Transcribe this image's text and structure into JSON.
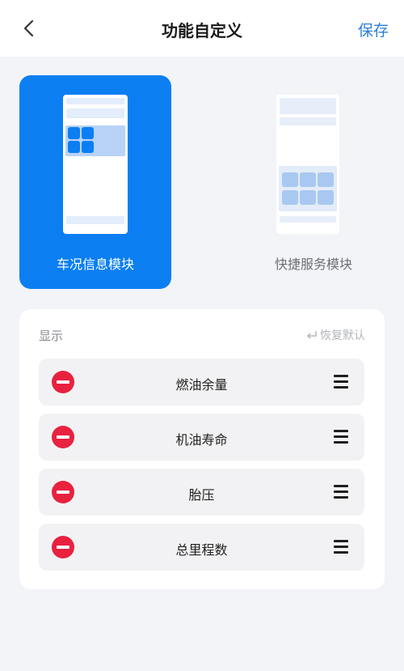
{
  "header": {
    "title": "功能自定义",
    "save_label": "保存",
    "back_icon": "chevron-left-icon"
  },
  "modules": [
    {
      "label": "车况信息模块",
      "selected": true
    },
    {
      "label": "快捷服务模块",
      "selected": false
    }
  ],
  "panel": {
    "section_label": "显示",
    "restore_label": "恢复默认",
    "restore_icon": "return-arrow-icon",
    "items": [
      {
        "label": "燃油余量"
      },
      {
        "label": "机油寿命"
      },
      {
        "label": "胎压"
      },
      {
        "label": "总里程数"
      }
    ]
  },
  "colors": {
    "accent": "#0b7ff2",
    "remove": "#e8213f",
    "link": "#2b7fd6"
  }
}
